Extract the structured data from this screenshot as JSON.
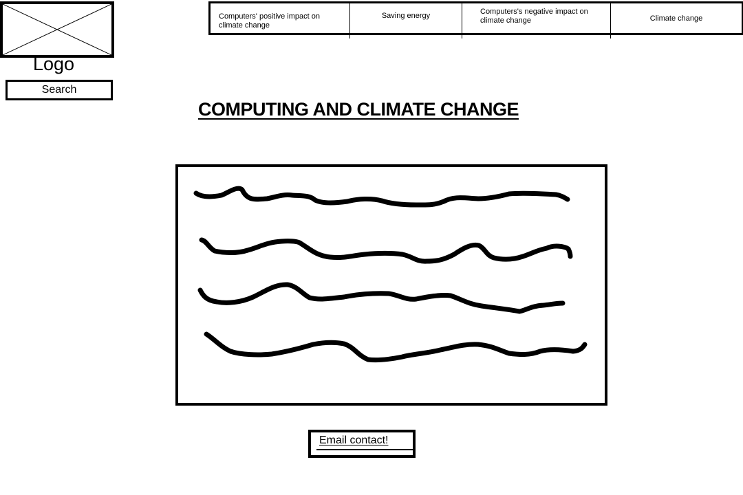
{
  "logo": {
    "label": "Logo",
    "icon": "image-placeholder-icon"
  },
  "search": {
    "label": "Search"
  },
  "nav": {
    "items": [
      {
        "label": "Computers' positive impact on climate change"
      },
      {
        "label": "Saving energy"
      },
      {
        "label": "Computers's negative impact on climate change"
      },
      {
        "label": "Climate change"
      }
    ]
  },
  "main": {
    "title": "COMPUTING AND CLIMATE CHANGE",
    "content_placeholder": "text-placeholder-scribble"
  },
  "footer": {
    "email_label": "Email contact!"
  }
}
